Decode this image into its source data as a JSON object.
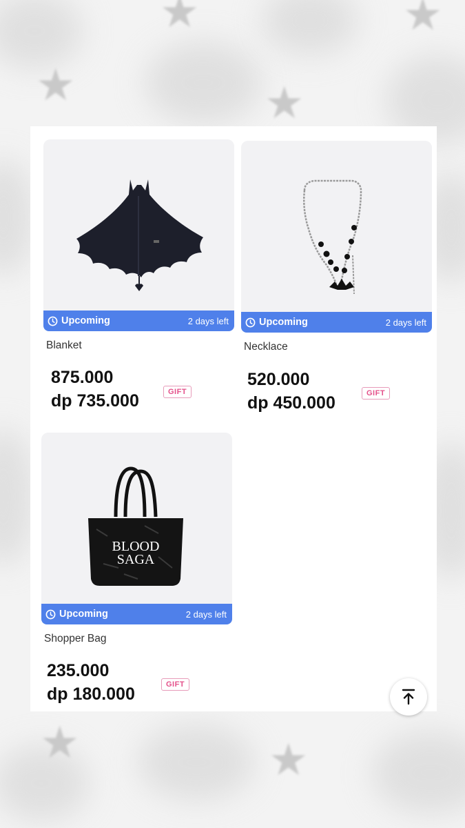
{
  "products": [
    {
      "name": "Blanket",
      "status": "Upcoming",
      "time_left": "2 days left",
      "price": "875.000",
      "dp_price": "dp 735.000",
      "badge": "GIFT",
      "image": "bat-cape-blanket"
    },
    {
      "name": "Necklace",
      "status": "Upcoming",
      "time_left": "2 days left",
      "price": "520.000",
      "dp_price": "dp 450.000",
      "badge": "GIFT",
      "image": "beaded-chain-necklace"
    },
    {
      "name": "Shopper Bag",
      "status": "Upcoming",
      "time_left": "2 days left",
      "price": "235.000",
      "dp_price": "dp 180.000",
      "badge": "GIFT",
      "image": "black-tote-bag"
    }
  ],
  "bag_print": {
    "line1": "BLOOD",
    "line2": "SAGA"
  },
  "colors": {
    "status_bar": "#4f80ea",
    "gift": "#e4508a",
    "background": "#f3f3f3"
  },
  "icons": {
    "status": "clock-icon",
    "scroll": "arrow-up-to-top-icon"
  }
}
